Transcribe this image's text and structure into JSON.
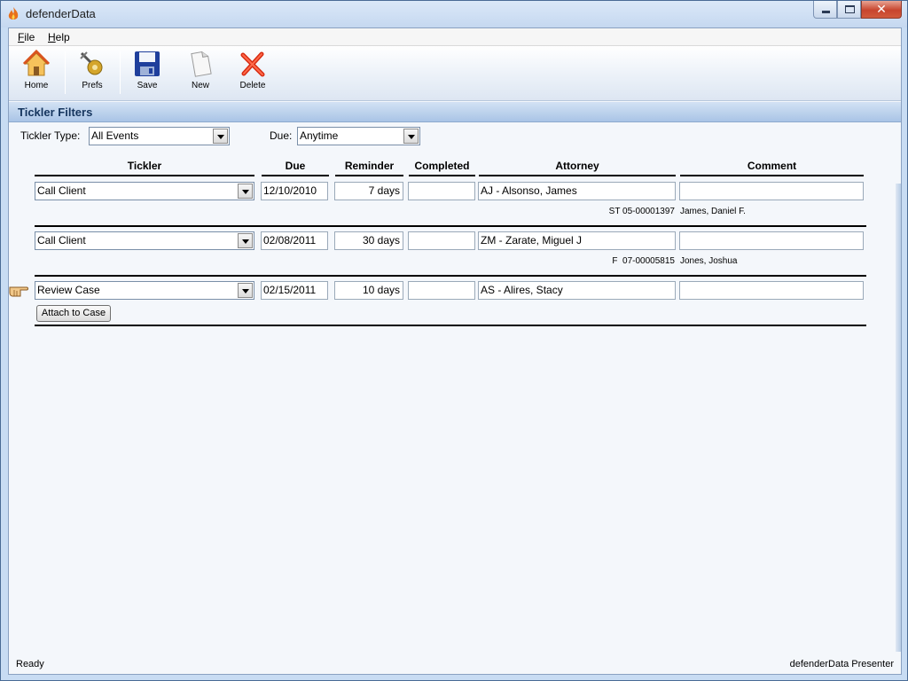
{
  "window": {
    "title": "defenderData"
  },
  "menu": {
    "file": "File",
    "file_key": "F",
    "file_rest": "ile",
    "help_key": "H",
    "help_rest": "elp"
  },
  "toolbar": {
    "home": "Home",
    "prefs": "Prefs",
    "save": "Save",
    "new": "New",
    "delete": "Delete"
  },
  "section": {
    "title": "Tickler Filters"
  },
  "filters": {
    "tickler_type_label": "Tickler Type:",
    "tickler_type_value": "All Events",
    "due_label": "Due:",
    "due_value": "Anytime"
  },
  "columns": {
    "tickler": "Tickler",
    "due": "Due",
    "reminder": "Reminder",
    "completed": "Completed",
    "attorney": "Attorney",
    "comment": "Comment"
  },
  "rows": [
    {
      "tickler": "Call Client",
      "due": "12/10/2010",
      "reminder": "7 days",
      "completed": "",
      "attorney": "AJ - Alsonso, James",
      "comment": "",
      "case": "ST 05-00001397",
      "client": "James, Daniel F."
    },
    {
      "tickler": "Call Client",
      "due": "02/08/2011",
      "reminder": "30 days",
      "completed": "",
      "attorney": "ZM - Zarate, Miguel J",
      "comment": "",
      "case": "F  07-00005815",
      "client": "Jones, Joshua"
    },
    {
      "tickler": "Review Case",
      "due": "02/15/2011",
      "reminder": "10 days",
      "completed": "",
      "attorney": "AS - Alires, Stacy",
      "comment": "",
      "attach_button": "Attach to Case"
    }
  ],
  "status": {
    "left": "Ready",
    "right": "defenderData Presenter"
  },
  "colors": {
    "title_bar": "#c5d8f0",
    "section_header": "#a9c4e6",
    "close_button": "#c8452e"
  },
  "icons": [
    "flame-icon",
    "home-icon",
    "prefs-icon",
    "save-icon",
    "new-document-icon",
    "delete-icon",
    "pointing-hand-icon",
    "dropdown-arrow-icon"
  ]
}
